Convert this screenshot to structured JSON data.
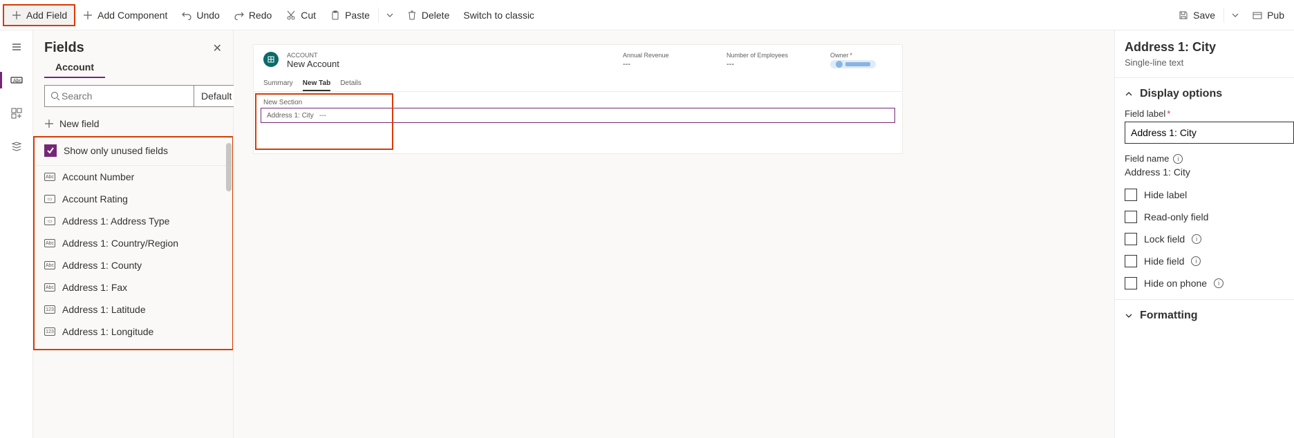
{
  "toolbar": {
    "add_field": "Add Field",
    "add_component": "Add Component",
    "undo": "Undo",
    "redo": "Redo",
    "cut": "Cut",
    "paste": "Paste",
    "delete": "Delete",
    "switch": "Switch to classic",
    "save": "Save",
    "publish": "Pub"
  },
  "fields_panel": {
    "title": "Fields",
    "entity": "Account",
    "search_placeholder": "Search",
    "default_label": "Default",
    "new_field": "New field",
    "show_unused": "Show only unused fields",
    "items": [
      {
        "icon": "Abc",
        "label": "Account Number"
      },
      {
        "icon": "▭",
        "label": "Account Rating"
      },
      {
        "icon": "▭",
        "label": "Address 1: Address Type"
      },
      {
        "icon": "Abc",
        "label": "Address 1: Country/Region"
      },
      {
        "icon": "Abc",
        "label": "Address 1: County"
      },
      {
        "icon": "Abc",
        "label": "Address 1: Fax"
      },
      {
        "icon": "123",
        "label": "Address 1: Latitude"
      },
      {
        "icon": "123",
        "label": "Address 1: Longitude"
      }
    ]
  },
  "form": {
    "entity_label": "ACCOUNT",
    "record_title": "New Account",
    "header_fields": [
      {
        "label": "Annual Revenue",
        "value": "---"
      },
      {
        "label": "Number of Employees",
        "value": "---"
      },
      {
        "label": "Owner",
        "value": "",
        "required": true,
        "owner": true
      }
    ],
    "tabs": [
      {
        "label": "Summary",
        "active": false
      },
      {
        "label": "New Tab",
        "active": true
      },
      {
        "label": "Details",
        "active": false
      }
    ],
    "section_label": "New Section",
    "field_label": "Address 1: City",
    "field_value": "---"
  },
  "props": {
    "title": "Address 1: City",
    "subtitle": "Single-line text",
    "section_display": "Display options",
    "field_label_label": "Field label",
    "field_label_value": "Address 1: City",
    "field_name_label": "Field name",
    "field_name_value": "Address 1: City",
    "checks": [
      {
        "label": "Hide label",
        "info": false
      },
      {
        "label": "Read-only field",
        "info": false
      },
      {
        "label": "Lock field",
        "info": true
      },
      {
        "label": "Hide field",
        "info": true
      },
      {
        "label": "Hide on phone",
        "info": true
      }
    ],
    "section_formatting": "Formatting"
  }
}
